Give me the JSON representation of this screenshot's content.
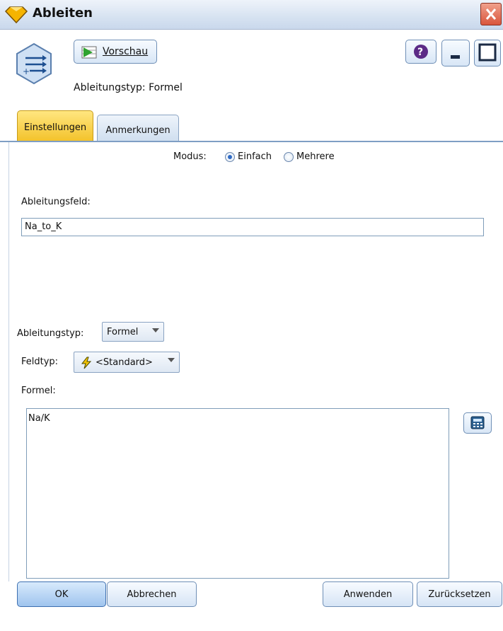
{
  "window": {
    "title": "Ableiten"
  },
  "toolbar": {
    "preview_label": "Vorschau",
    "subtitle": "Ableitungstyp: Formel"
  },
  "tabs": [
    {
      "label": "Einstellungen",
      "active": true
    },
    {
      "label": "Anmerkungen",
      "active": false
    }
  ],
  "form": {
    "mode_label": "Modus:",
    "mode_options": [
      {
        "label": "Einfach",
        "checked": true
      },
      {
        "label": "Mehrere",
        "checked": false
      }
    ],
    "derive_field_label": "Ableitungsfeld:",
    "derive_field_value": "Na_to_K",
    "derive_type_label": "Ableitungstyp:",
    "derive_type_value": "Formel",
    "field_type_label": "Feldtyp:",
    "field_type_value": "<Standard>",
    "formula_label": "Formel:",
    "formula_value": "Na/K"
  },
  "buttons": {
    "ok": "OK",
    "cancel": "Abbrechen",
    "apply": "Anwenden",
    "reset": "Zurücksetzen"
  },
  "colors": {
    "active_tab": "#f3c22a",
    "accent": "#2f6ac4"
  }
}
